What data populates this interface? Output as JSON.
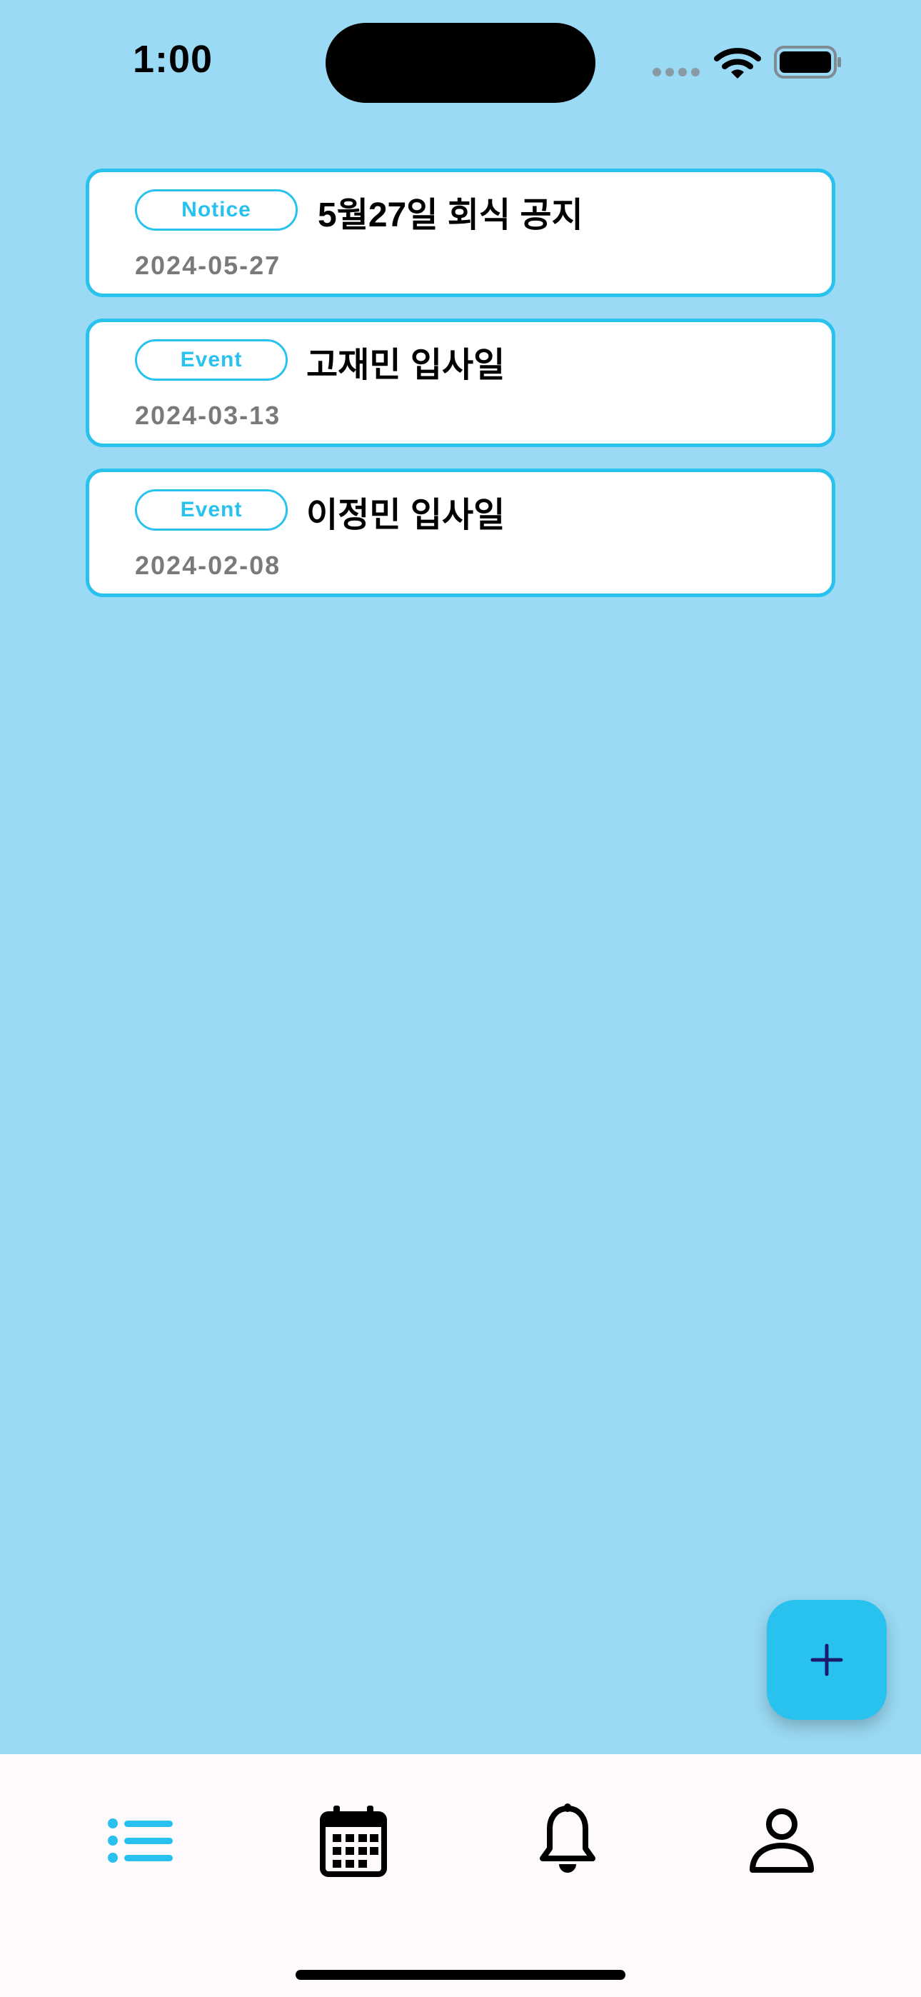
{
  "status_bar": {
    "time": "1:00"
  },
  "items": [
    {
      "tag": "Notice",
      "title": "5월27일 회식 공지",
      "date": "2024-05-27"
    },
    {
      "tag": "Event",
      "title": "고재민 입사일",
      "date": "2024-03-13"
    },
    {
      "tag": "Event",
      "title": "이정민 입사일",
      "date": "2024-02-08"
    }
  ],
  "fab": {
    "icon": "plus-icon"
  },
  "tabs": [
    {
      "icon": "list-icon",
      "active": true
    },
    {
      "icon": "calendar-icon",
      "active": false
    },
    {
      "icon": "bell-icon",
      "active": false
    },
    {
      "icon": "person-icon",
      "active": false
    }
  ],
  "colors": {
    "background": "#9bdaf4",
    "accent": "#29c2ee",
    "card": "#ffffff",
    "date_text": "#7a7a7a",
    "tabbar": "#fdf9fd"
  }
}
